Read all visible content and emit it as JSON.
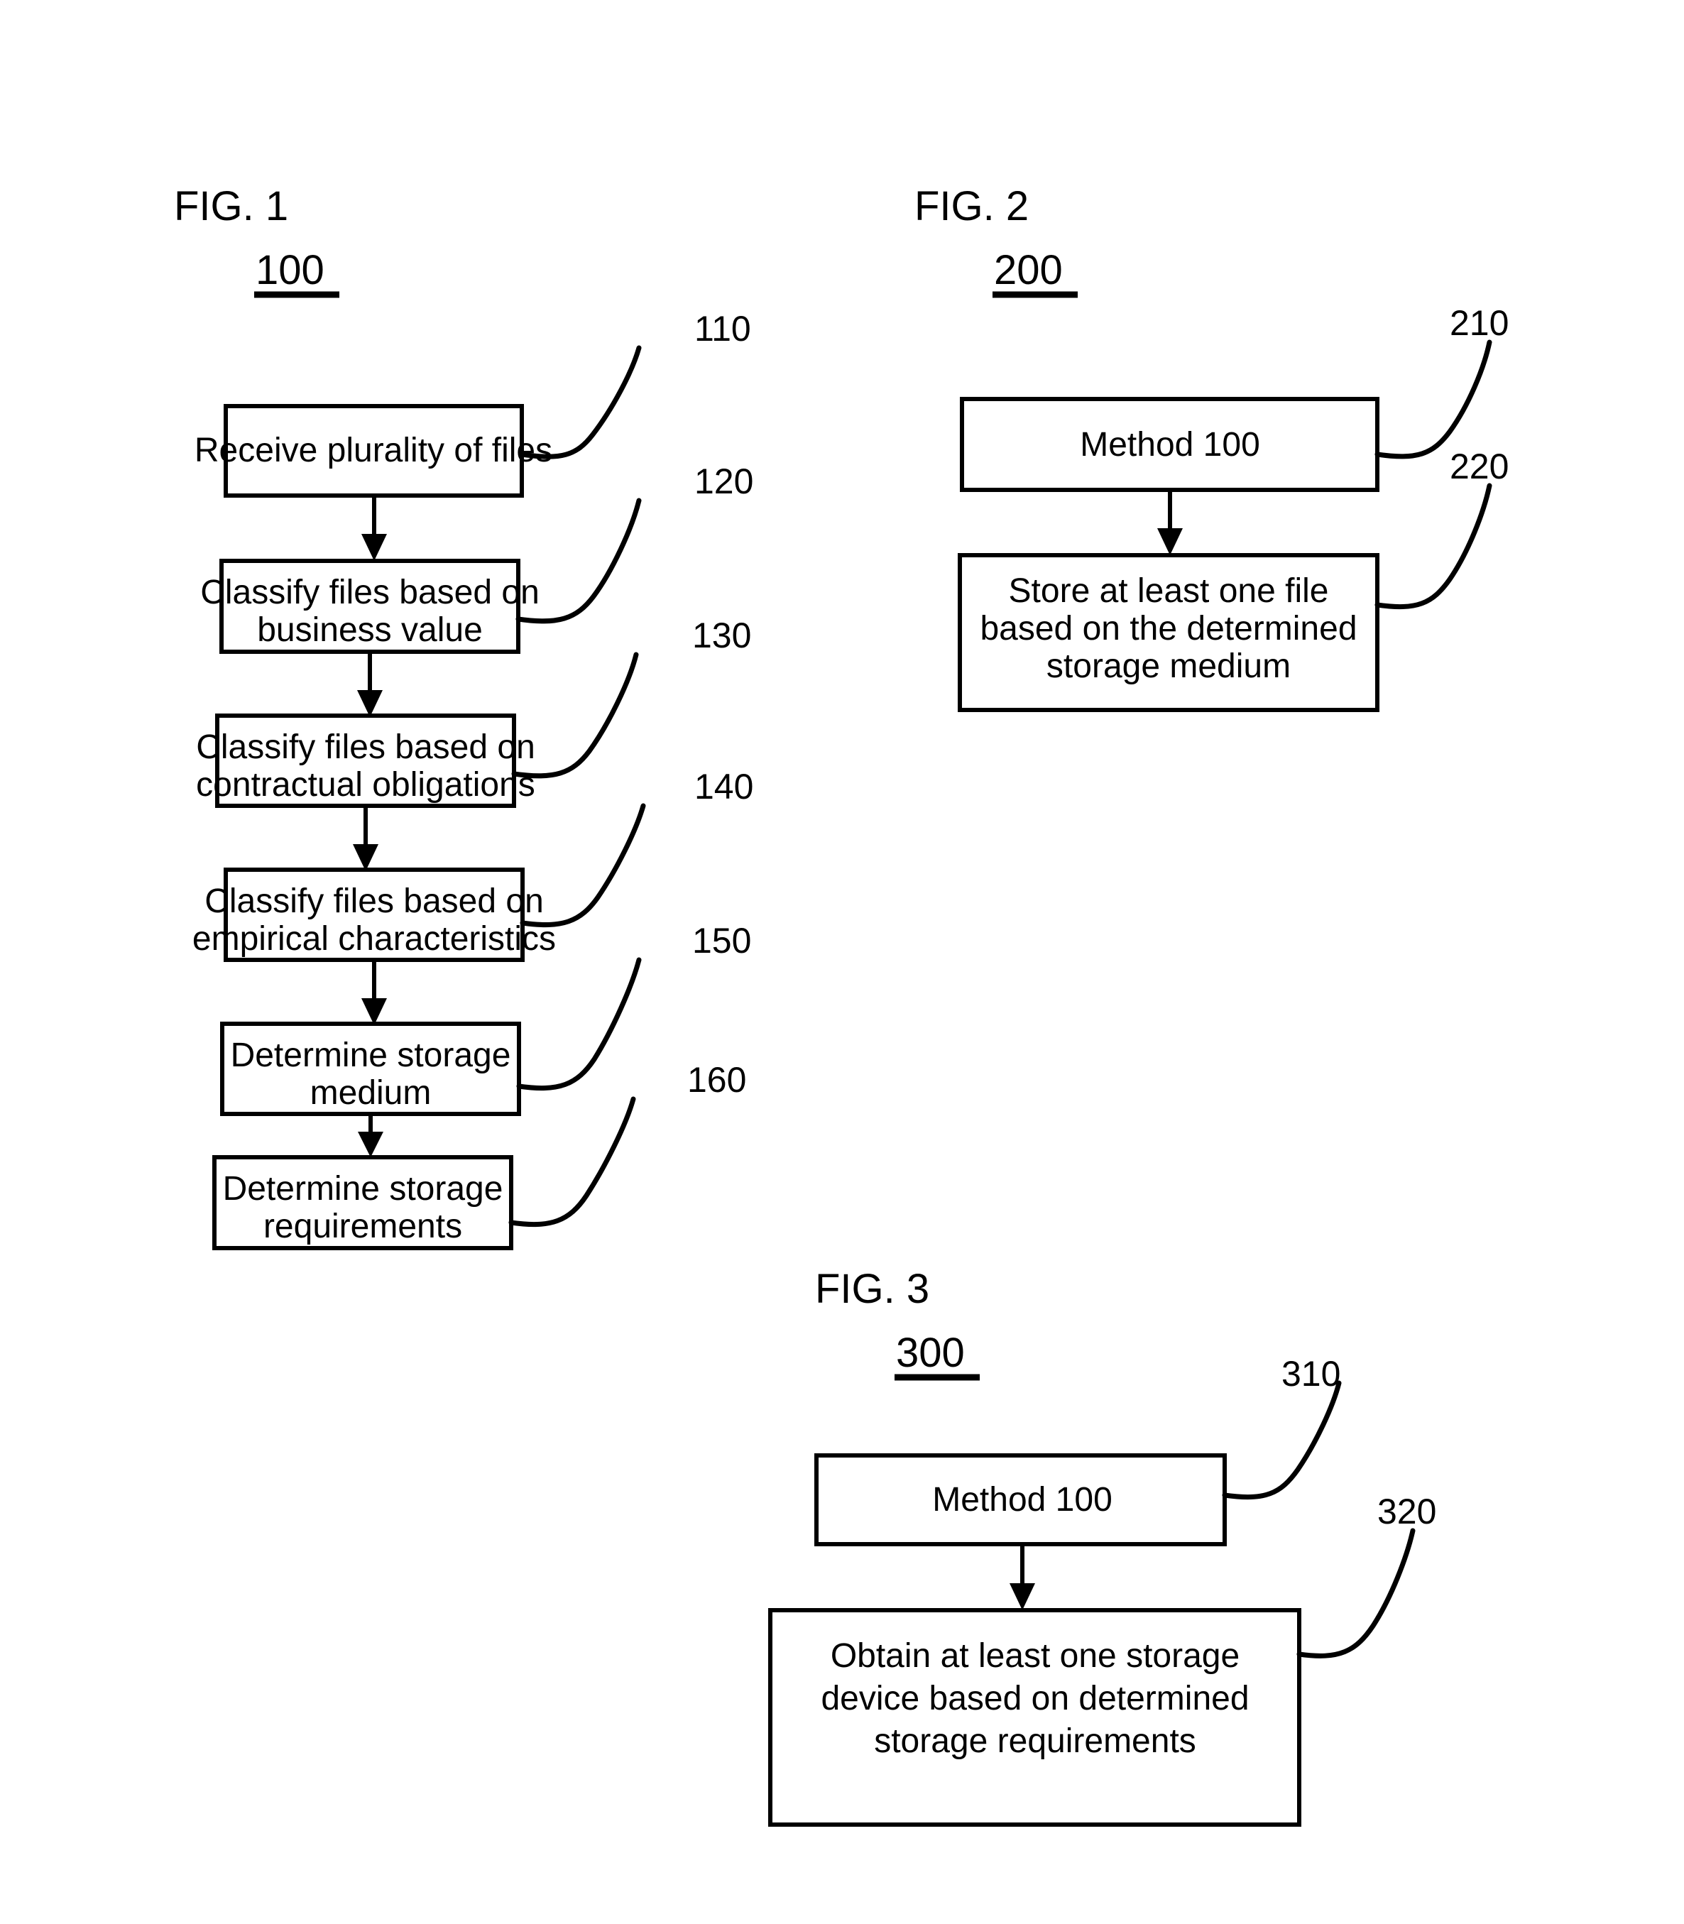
{
  "document": {
    "type": "patent-flowchart-sheet",
    "background": "#ffffff",
    "ink": "#000000"
  },
  "figures": [
    {
      "id": "fig1",
      "title": "FIG. 1",
      "number": "100",
      "boxes": [
        {
          "ref": "110",
          "lines": [
            "Receive plurality of files"
          ]
        },
        {
          "ref": "120",
          "lines": [
            "Classify files based on",
            "business value"
          ]
        },
        {
          "ref": "130",
          "lines": [
            "Classify files based on",
            "contractual obligations"
          ]
        },
        {
          "ref": "140",
          "lines": [
            "Classify files based on",
            "empirical characteristics"
          ]
        },
        {
          "ref": "150",
          "lines": [
            "Determine storage",
            "medium"
          ]
        },
        {
          "ref": "160",
          "lines": [
            "Determine storage",
            "requirements"
          ]
        }
      ]
    },
    {
      "id": "fig2",
      "title": "FIG. 2",
      "number": "200",
      "boxes": [
        {
          "ref": "210",
          "lines": [
            "Method 100"
          ]
        },
        {
          "ref": "220",
          "lines": [
            "Store at least one file",
            "based on the determined",
            "storage medium"
          ]
        }
      ]
    },
    {
      "id": "fig3",
      "title": "FIG. 3",
      "number": "300",
      "boxes": [
        {
          "ref": "310",
          "lines": [
            "Method  100"
          ]
        },
        {
          "ref": "320",
          "lines": [
            "Obtain at least one storage",
            "device based on determined",
            "storage requirements"
          ]
        }
      ]
    }
  ]
}
